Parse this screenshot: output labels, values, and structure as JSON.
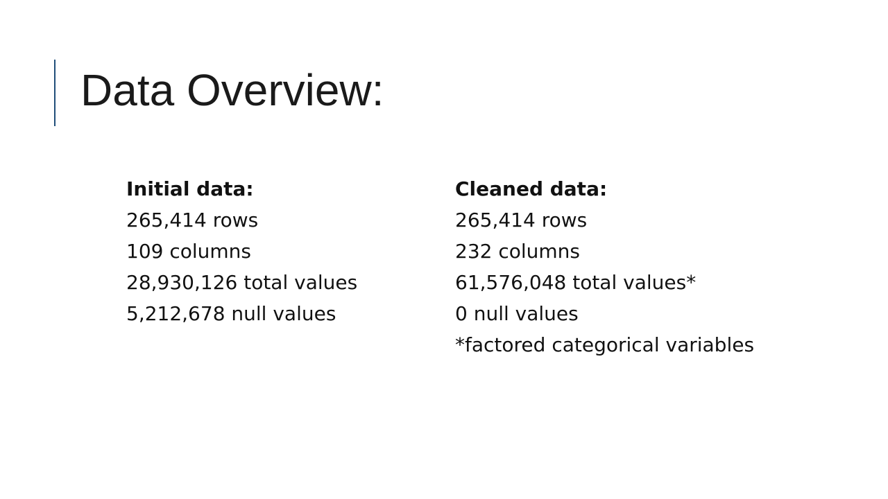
{
  "slide": {
    "title": "Data Overview:",
    "accent_color": "#1f4e79"
  },
  "initial": {
    "heading": "Initial data:",
    "lines": [
      "265,414 rows",
      "109 columns",
      "28,930,126 total values",
      "5,212,678 null values"
    ]
  },
  "cleaned": {
    "heading": "Cleaned data:",
    "lines": [
      "265,414 rows",
      "232 columns",
      "61,576,048 total values*",
      "0 null values",
      "*factored categorical variables"
    ]
  }
}
